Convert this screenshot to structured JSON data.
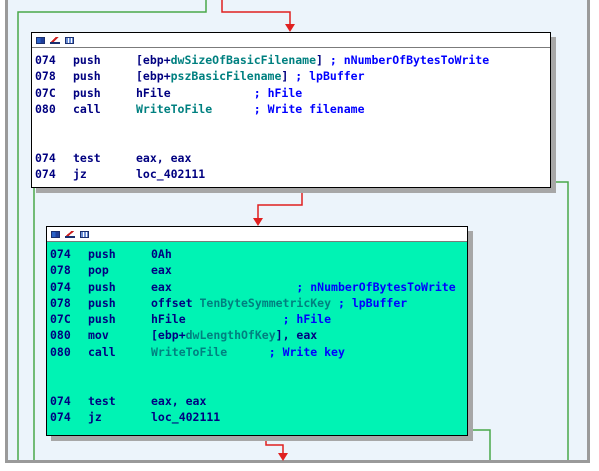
{
  "node1": {
    "rows": [
      {
        "addr": "074",
        "mn": "push",
        "pre": "[ebp+",
        "sym": "dwSizeOfBasicFilename",
        "post": "]",
        "pad": " ",
        "cmt": "; nNumberOfBytesToWrite"
      },
      {
        "addr": "078",
        "mn": "push",
        "pre": "[ebp+",
        "sym": "pszBasicFilename",
        "post": "]",
        "pad": " ",
        "cmt": "; lpBuffer"
      },
      {
        "addr": "07C",
        "mn": "push",
        "pre": "hFile",
        "sym": "",
        "post": "",
        "pad": "            ",
        "cmt": "; hFile"
      },
      {
        "addr": "080",
        "mn": "call",
        "pre": "",
        "sym": "WriteToFile",
        "post": "",
        "pad": "      ",
        "cmt": "; Write filename"
      },
      {
        "blank": true
      },
      {
        "blank": true
      },
      {
        "addr": "074",
        "mn": "test",
        "pre": "eax, eax",
        "sym": "",
        "post": "",
        "pad": "",
        "cmt": ""
      },
      {
        "addr": "074",
        "mn": "jz",
        "pre": "loc_402111",
        "sym": "",
        "post": "",
        "pad": "",
        "cmt": ""
      }
    ]
  },
  "node2": {
    "rows": [
      {
        "addr": "074",
        "mn": "push",
        "pre": "0Ah",
        "sym": "",
        "post": "",
        "pad": "",
        "cmt": ""
      },
      {
        "addr": "078",
        "mn": "pop",
        "pre": "eax",
        "sym": "",
        "post": "",
        "pad": "",
        "cmt": ""
      },
      {
        "addr": "074",
        "mn": "push",
        "pre": "eax",
        "sym": "",
        "post": "",
        "pad": "                  ",
        "cmt": "; nNumberOfBytesToWrite"
      },
      {
        "addr": "078",
        "mn": "push",
        "pre": "offset ",
        "sym": "TenByteSymmetricKey",
        "post": "",
        "pad": " ",
        "cmt": "; lpBuffer"
      },
      {
        "addr": "07C",
        "mn": "push",
        "pre": "hFile",
        "sym": "",
        "post": "",
        "pad": "              ",
        "cmt": "; hFile"
      },
      {
        "addr": "080",
        "mn": "mov",
        "pre": "[ebp+",
        "sym": "dwLengthOfKey",
        "post": "], eax",
        "pad": "",
        "cmt": ""
      },
      {
        "addr": "080",
        "mn": "call",
        "pre": "",
        "sym": "WriteToFile",
        "post": "",
        "pad": "      ",
        "cmt": "; Write key"
      },
      {
        "blank": true
      },
      {
        "blank": true
      },
      {
        "addr": "074",
        "mn": "test",
        "pre": "eax, eax",
        "sym": "",
        "post": "",
        "pad": "",
        "cmt": ""
      },
      {
        "addr": "074",
        "mn": "jz",
        "pre": "loc_402111",
        "sym": "",
        "post": "",
        "pad": "",
        "cmt": ""
      }
    ]
  },
  "colors": {
    "frame_bg": "#ecf4fb",
    "node2_bg": "#00f3b4",
    "edge_green": "#4aa84a",
    "edge_red": "#e02020"
  }
}
